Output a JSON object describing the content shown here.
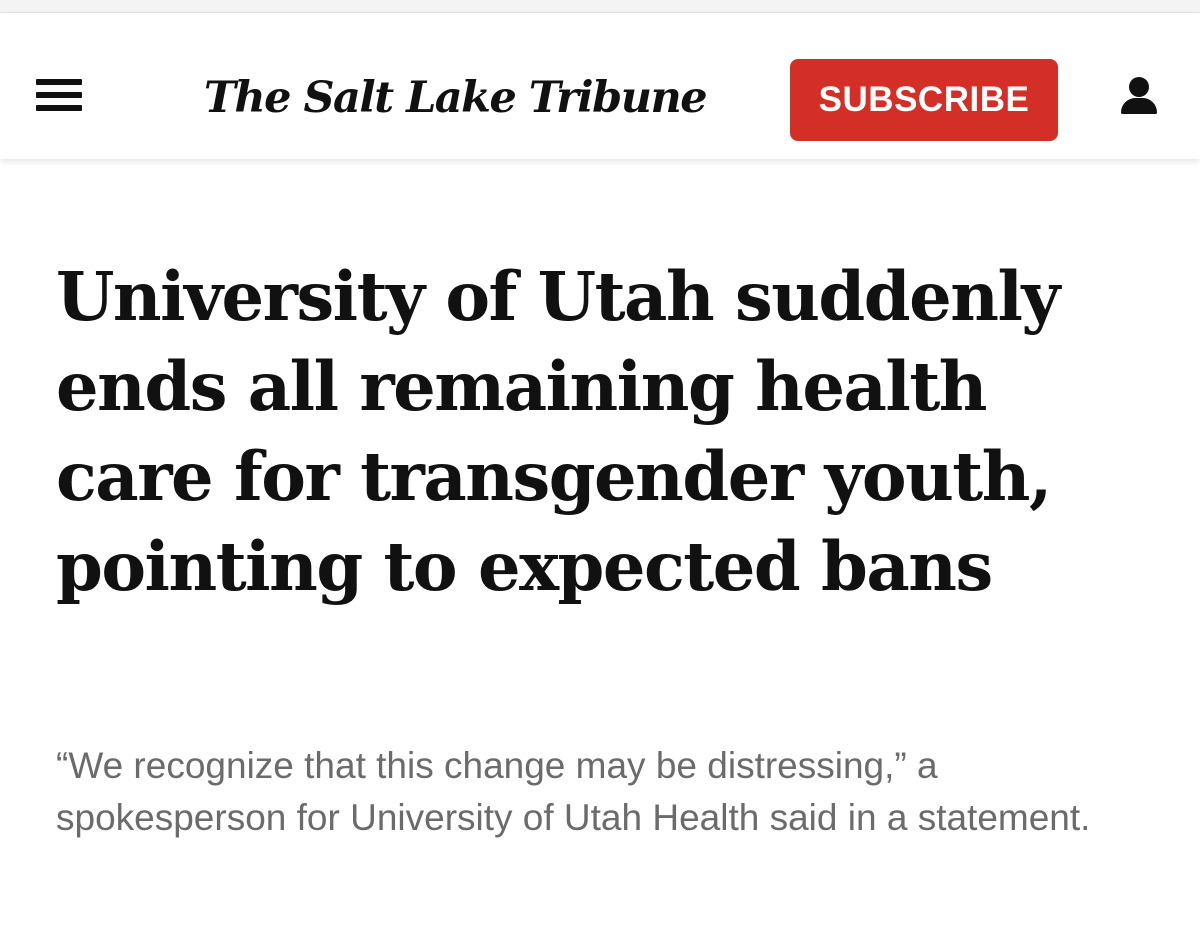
{
  "header": {
    "logo_text": "The Salt Lake Tribune",
    "subscribe_label": "SUBSCRIBE",
    "menu_icon": "hamburger-menu-icon",
    "account_icon": "user-icon",
    "subscribe_color": "#d42f26"
  },
  "article": {
    "headline": "University of Utah suddenly ends all remaining health care for transgender youth, pointing to expected bans",
    "dek": "“We recognize that this change may be distressing,” a spokesperson for University of Utah Health said in a statement."
  }
}
